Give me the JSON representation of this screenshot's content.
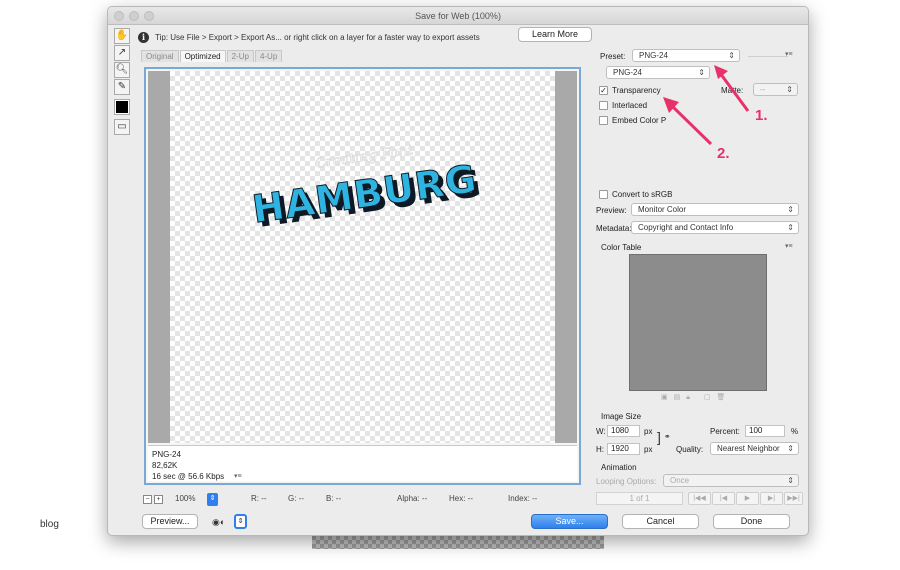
{
  "window": {
    "title": "Save for Web (100%)"
  },
  "tip": {
    "text": "Tip: Use File > Export > Export As...  or right click on a layer for a faster way to export assets",
    "learn_more": "Learn More"
  },
  "tabs": [
    {
      "label": "Original"
    },
    {
      "label": "Optimized"
    },
    {
      "label": "2-Up"
    },
    {
      "label": "4-Up"
    }
  ],
  "canvas": {
    "artwork_script": "Creating Font",
    "artwork_title": "HAMBURG",
    "info_line1": "PNG-24",
    "info_line2": "82,62K",
    "info_line3": "16 sec @ 56.6 Kbps"
  },
  "statusbar": {
    "zoom": "100%",
    "r": "R: --",
    "g": "G: --",
    "b": "B: --",
    "alpha": "Alpha: --",
    "hex": "Hex: --",
    "index": "Index: --"
  },
  "footer": {
    "preview": "Preview...",
    "save": "Save...",
    "cancel": "Cancel",
    "done": "Done"
  },
  "panel": {
    "preset_label": "Preset:",
    "preset_value": "PNG-24",
    "format_value": "PNG-24",
    "transparency": "Transparency",
    "interlaced": "Interlaced",
    "embed_color": "Embed Color P",
    "matte_label": "Matte:",
    "matte_value": "--",
    "convert_srgb": "Convert to sRGB",
    "preview_label": "Preview:",
    "preview_value": "Monitor Color",
    "metadata_label": "Metadata:",
    "metadata_value": "Copyright and Contact Info",
    "color_table": "Color Table",
    "image_size": "Image Size",
    "w_label": "W:",
    "w_value": "1080",
    "h_label": "H:",
    "h_value": "1920",
    "px": "px",
    "percent_label": "Percent:",
    "percent_value": "100",
    "percent_unit": "%",
    "quality_label": "Quality:",
    "quality_value": "Nearest Neighbor",
    "animation": "Animation",
    "looping_label": "Looping Options:",
    "looping_value": "Once",
    "frame_counter": "1 of 1"
  },
  "annotations": {
    "one": "1.",
    "two": "2."
  },
  "outside": {
    "blog_label": "blog"
  },
  "colors": {
    "accent": "#2f80ed",
    "annotation": "#e8316b",
    "hamburg_blue": "#2fb3e0"
  },
  "checkbox_states": {
    "transparency": true,
    "interlaced": false,
    "embed_color": false,
    "convert_srgb": false
  }
}
